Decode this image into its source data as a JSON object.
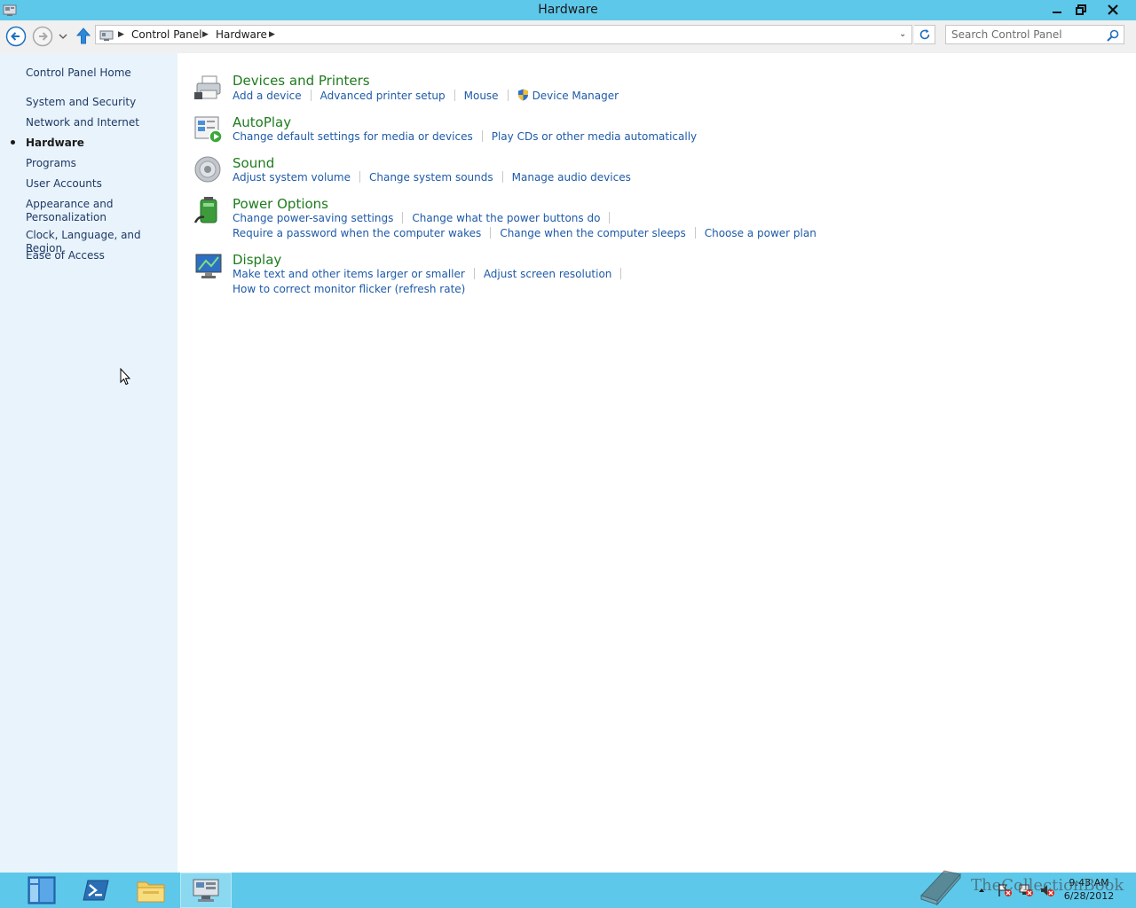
{
  "window": {
    "title": "Hardware"
  },
  "address": {
    "breadcrumbs": [
      "Control Panel",
      "Hardware"
    ]
  },
  "search": {
    "placeholder": "Search Control Panel"
  },
  "sidebar": {
    "items": [
      {
        "label": "Control Panel Home"
      },
      {
        "label": "System and Security"
      },
      {
        "label": "Network and Internet"
      },
      {
        "label": "Hardware",
        "active": true
      },
      {
        "label": "Programs"
      },
      {
        "label": "User Accounts"
      },
      {
        "label": "Appearance and Personalization",
        "line1": "Appearance and",
        "line2": "Personalization"
      },
      {
        "label": "Clock, Language, and Region"
      },
      {
        "label": "Ease of Access"
      }
    ]
  },
  "categories": [
    {
      "title": "Devices and Printers",
      "icon": "printer-icon",
      "links": [
        "Add a device",
        "Advanced printer setup",
        "Mouse",
        "Device Manager"
      ]
    },
    {
      "title": "AutoPlay",
      "icon": "autoplay-icon",
      "links": [
        "Change default settings for media or devices",
        "Play CDs or other media automatically"
      ]
    },
    {
      "title": "Sound",
      "icon": "speaker-icon",
      "links": [
        "Adjust system volume",
        "Change system sounds",
        "Manage audio devices"
      ]
    },
    {
      "title": "Power Options",
      "icon": "battery-icon",
      "links": [
        "Change power-saving settings",
        "Change what the power buttons do",
        "Require a password when the computer wakes",
        "Change when the computer sleeps",
        "Choose a power plan"
      ]
    },
    {
      "title": "Display",
      "icon": "monitor-icon",
      "links": [
        "Make text and other items larger or smaller",
        "Adjust screen resolution",
        "How to correct monitor flicker (refresh rate)"
      ]
    }
  ],
  "taskbar": {
    "apps": [
      "server-manager-icon",
      "powershell-icon",
      "file-explorer-icon",
      "control-panel-icon"
    ]
  },
  "clock": {
    "time": "9:43 AM",
    "date": "6/28/2012"
  },
  "watermark": {
    "text": "TheCollectionBook"
  },
  "colors": {
    "titlebar": "#5ec8ea",
    "sidebar": "#e9f3fb",
    "heading": "#1e7b1e",
    "link": "#1e5aa8"
  }
}
